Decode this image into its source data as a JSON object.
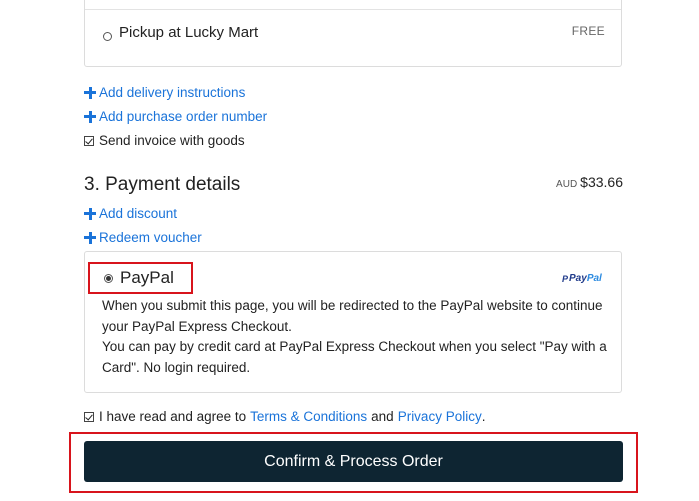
{
  "shipping": {
    "option_label": "Pickup at Lucky Mart",
    "option_price": "FREE"
  },
  "links": {
    "delivery_instructions": "Add delivery instructions",
    "purchase_order": "Add purchase order number"
  },
  "invoice": {
    "label": "Send invoice with goods",
    "checked": true
  },
  "payment": {
    "section_title": "3. Payment details",
    "currency": "AUD",
    "total": "$33.66",
    "add_discount": "Add discount",
    "redeem_voucher": "Redeem voucher",
    "method_label": "PayPal",
    "logo_text_pay": "Pay",
    "logo_text_pal": "Pal",
    "logo_mark": "P",
    "description_line1": "When you submit this page, you will be redirected to the PayPal website to continue your PayPal Express Checkout.",
    "description_line2": "You can pay by credit card at PayPal Express Checkout when you select \"Pay with a Card\". No login required."
  },
  "agreement": {
    "prefix": "I have read and agree to",
    "terms_link": "Terms & Conditions",
    "middle": "and",
    "privacy_link": "Privacy Policy",
    "suffix": ".",
    "checked": true
  },
  "confirm_button": "Confirm & Process Order",
  "colors": {
    "link": "#1a73d9",
    "highlight": "#d8141c",
    "button_bg": "#0e2532"
  }
}
